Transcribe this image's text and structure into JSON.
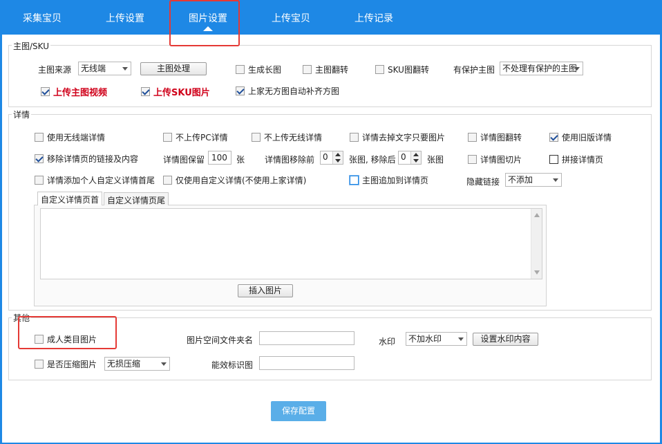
{
  "tabs": [
    {
      "label": "采集宝贝"
    },
    {
      "label": "上传设置"
    },
    {
      "label": "图片设置"
    },
    {
      "label": "上传宝贝"
    },
    {
      "label": "上传记录"
    }
  ],
  "main_image": {
    "group_title": "主图/SKU",
    "source_label": "主图来源",
    "source_value": "无线端",
    "process_button": "主图处理",
    "gen_long_image": "生成长图",
    "flip_main": "主图翻转",
    "flip_sku": "SKU图翻转",
    "protected_label": "有保护主图",
    "protected_value": "不处理有保护的主图",
    "upload_video": "上传主图视频",
    "upload_sku_image": "上传SKU图片",
    "auto_square": "上家无方图自动补齐方图"
  },
  "detail": {
    "group_title": "详情",
    "use_wireless": "使用无线端详情",
    "no_pc_detail": "不上传PC详情",
    "no_wireless_detail": "不上传无线详情",
    "remove_text_keep_images": "详情去掉文字只要图片",
    "flip_detail_image": "详情图翻转",
    "use_old_detail": "使用旧版详情",
    "remove_links": "移除详情页的链接及内容",
    "keep_label": "详情图保留",
    "keep_value": "100",
    "keep_unit": "张",
    "remove_front_label": "详情图移除前",
    "remove_front_value": "0",
    "remove_after_label": "张图, 移除后",
    "remove_after_value": "0",
    "remove_after_unit": "张图",
    "slice_detail": "详情图切片",
    "join_detail": "拼接详情页",
    "add_custom_header": "详情添加个人自定义详情首尾",
    "only_custom": "仅使用自定义详情(不使用上家详情)",
    "append_main_image": "主图追加到详情页",
    "hide_link_label": "隐藏链接",
    "hide_link_value": "不添加",
    "subtab_header": "自定义详情页首",
    "subtab_footer": "自定义详情页尾",
    "insert_image_button": "插入图片"
  },
  "other": {
    "group_title": "其他",
    "adult_images": "成人类目图片",
    "folder_label": "图片空间文件夹名",
    "folder_value": "",
    "watermark_label": "水印",
    "watermark_value": "不加水印",
    "watermark_button": "设置水印内容",
    "compress": "是否压缩图片",
    "compress_value": "无损压缩",
    "efficacy_label": "能效标识图",
    "efficacy_value": ""
  },
  "save_button": "保存配置"
}
